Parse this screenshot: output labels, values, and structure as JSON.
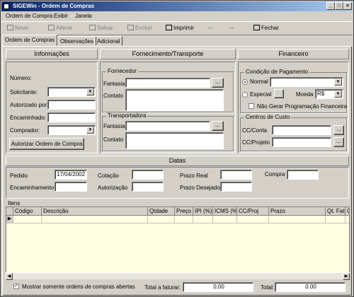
{
  "window": {
    "title": "SIGEWin - Ordem de Compras"
  },
  "menu": [
    "Ordem de Compra",
    "Exibir",
    "Janela"
  ],
  "toolbar": {
    "novo": "Novo",
    "alterar": "Alterar",
    "salvar": "Salvar",
    "excluir": "Excluir",
    "imprimir": "Imprimir",
    "fechar": "Fechar"
  },
  "tabs": [
    "Ordem de Compras",
    "Observações",
    "Adicional"
  ],
  "sections": {
    "informacoes": "Informações",
    "fornecimento": "Fornecimento/Transporte",
    "financeiro": "Financeiro",
    "datas": "Datas",
    "itens": "Itens"
  },
  "info": {
    "numero_label": "Número:",
    "solicitante_label": "Solicitante:",
    "autorizado_label": "Autorizado por:",
    "encaminhado_label": "Encaminhado:",
    "comprador_label": "Comprador:",
    "autorizar_button": "Autorizar Ordem de Compra"
  },
  "fornecedor": {
    "group": "Fornecedor",
    "fantasia": "Fantasia",
    "contato": "Contato",
    "lookup": "..."
  },
  "transportadora": {
    "group": "Transportadora",
    "fantasia": "Fantasia",
    "contato": "Contato",
    "lookup": "..."
  },
  "financeiro": {
    "condicao_group": "Condição de Pagamento",
    "normal": "Normal",
    "especial": "Especial",
    "moeda_label": "Moeda",
    "moeda_value": "R$",
    "nao_gerar": "Não Gerar Programação Financeira",
    "centros_group": "Centros de Custo",
    "cc_conta": "CC/Conta",
    "cc_projeto": "CC/Projeto",
    "lookup": "..."
  },
  "datas": {
    "pedido_label": "Pedido",
    "pedido_value": "17/04/2002",
    "encaminhamento_label": "Encaminhamento",
    "cotacao_label": "Cotação",
    "autorizacao_label": "Autorização",
    "prazo_real_label": "Prazo Real",
    "prazo_desejado_label": "Prazo Desejado",
    "compra_label": "Compra"
  },
  "grid": {
    "columns": [
      "Código",
      "Descrição",
      "Qtdade",
      "Preço",
      "IPI (%)",
      "ICMS (%)",
      "CC/Proj",
      "Prazo",
      "Qt. Fat.",
      "C"
    ]
  },
  "footer": {
    "mostrar_label": "Mostrar somente ordens de compras abertas",
    "total_faturar_label": "Total a faturar:",
    "total_faturar_value": "0.00",
    "total_label": "Total:",
    "total_value": "0.00"
  }
}
